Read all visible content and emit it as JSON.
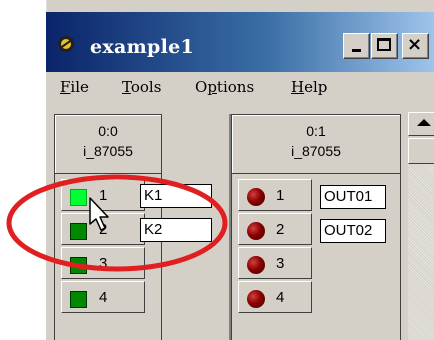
{
  "window": {
    "title": "example1"
  },
  "menubar": {
    "file": {
      "acc": "F",
      "rest": "ile"
    },
    "tools": {
      "acc": "T",
      "rest": "ools"
    },
    "options": {
      "pre": "O",
      "acc": "p",
      "rest": "tions"
    },
    "help": {
      "acc": "H",
      "rest": "elp"
    }
  },
  "modules": [
    {
      "address": "0:0",
      "name": "i_87055",
      "channels": [
        {
          "num": "1",
          "label": "K1",
          "state": "on"
        },
        {
          "num": "2",
          "label": "K2",
          "state": "off"
        },
        {
          "num": "3",
          "label": "",
          "state": "off"
        },
        {
          "num": "4",
          "label": "",
          "state": "off"
        }
      ]
    },
    {
      "address": "0:1",
      "name": "i_87055",
      "channels": [
        {
          "num": "1",
          "label": "OUT01"
        },
        {
          "num": "2",
          "label": "OUT02"
        },
        {
          "num": "3",
          "label": ""
        },
        {
          "num": "4",
          "label": ""
        }
      ]
    }
  ],
  "colors": {
    "led_on": "#00ff33",
    "led_off": "#008800",
    "output_led": "#8b0000",
    "annotation": "#e02020"
  },
  "icons": [
    "app-icon",
    "minimize-icon",
    "maximize-icon",
    "close-icon",
    "scroll-up-icon",
    "mouse-cursor-icon"
  ]
}
